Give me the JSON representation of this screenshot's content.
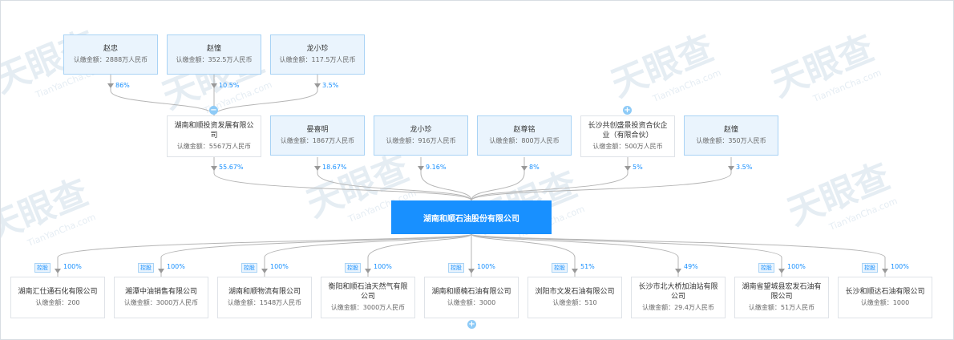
{
  "watermark": {
    "logo": "天眼查",
    "sub": "TianYanCha.com"
  },
  "center": {
    "name": "湖南和顺石油股份有限公司"
  },
  "shareholders_top": [
    {
      "name": "赵忠",
      "amount": "认缴金额：2888万人民币",
      "pct": "86%"
    },
    {
      "name": "赵憧",
      "amount": "认缴金额：352.5万人民币",
      "pct": "10.5%"
    },
    {
      "name": "龙小珍",
      "amount": "认缴金额：117.5万人民币",
      "pct": "3.5%"
    }
  ],
  "shareholders": [
    {
      "name": "湖南和顺投资发展有限公司",
      "amount": "认缴金额：5567万人民币",
      "pct": "55.67%",
      "style": "company"
    },
    {
      "name": "晏喜明",
      "amount": "认缴金额：1867万人民币",
      "pct": "18.67%",
      "style": "shareholder"
    },
    {
      "name": "龙小珍",
      "amount": "认缴金额：916万人民币",
      "pct": "9.16%",
      "style": "shareholder"
    },
    {
      "name": "赵尊铭",
      "amount": "认缴金额：800万人民币",
      "pct": "8%",
      "style": "shareholder"
    },
    {
      "name": "长沙共创盛景投资合伙企业（有限合伙）",
      "amount": "认缴金额：500万人民币",
      "pct": "5%",
      "style": "company"
    },
    {
      "name": "赵憧",
      "amount": "认缴金额：350万人民币",
      "pct": "3.5%",
      "style": "shareholder"
    }
  ],
  "investments": [
    {
      "name": "湖南汇仕通石化有限公司",
      "amount": "认缴金额：200",
      "pct": "100%",
      "tag": "控股"
    },
    {
      "name": "湘潭中油销售有限公司",
      "amount": "认缴金额：3000万人民币",
      "pct": "100%",
      "tag": "控股"
    },
    {
      "name": "湖南和顺物流有限公司",
      "amount": "认缴金额：1548万人民币",
      "pct": "100%",
      "tag": "控股"
    },
    {
      "name": "衡阳和顺石油天然气有限公司",
      "amount": "认缴金额：3000万人民币",
      "pct": "100%",
      "tag": "控股"
    },
    {
      "name": "湖南和顺楠石油有限公司",
      "amount": "认缴金额：3000",
      "pct": "100%",
      "tag": "控股"
    },
    {
      "name": "浏阳市文发石油有限公司",
      "amount": "认缴金额：510",
      "pct": "51%",
      "tag": "控股"
    },
    {
      "name": "长沙市北大桥加油站有限公司",
      "amount": "认缴金额：29.4万人民币",
      "pct": "49%",
      "tag": ""
    },
    {
      "name": "湖南省望城县宏发石油有限公司",
      "amount": "认缴金额：51万人民币",
      "pct": "100%",
      "tag": "控股"
    },
    {
      "name": "长沙和顺达石油有限公司",
      "amount": "认缴金额：1000",
      "pct": "100%",
      "tag": "控股"
    }
  ],
  "toggles": {
    "collapse": "−",
    "expand": "+"
  }
}
